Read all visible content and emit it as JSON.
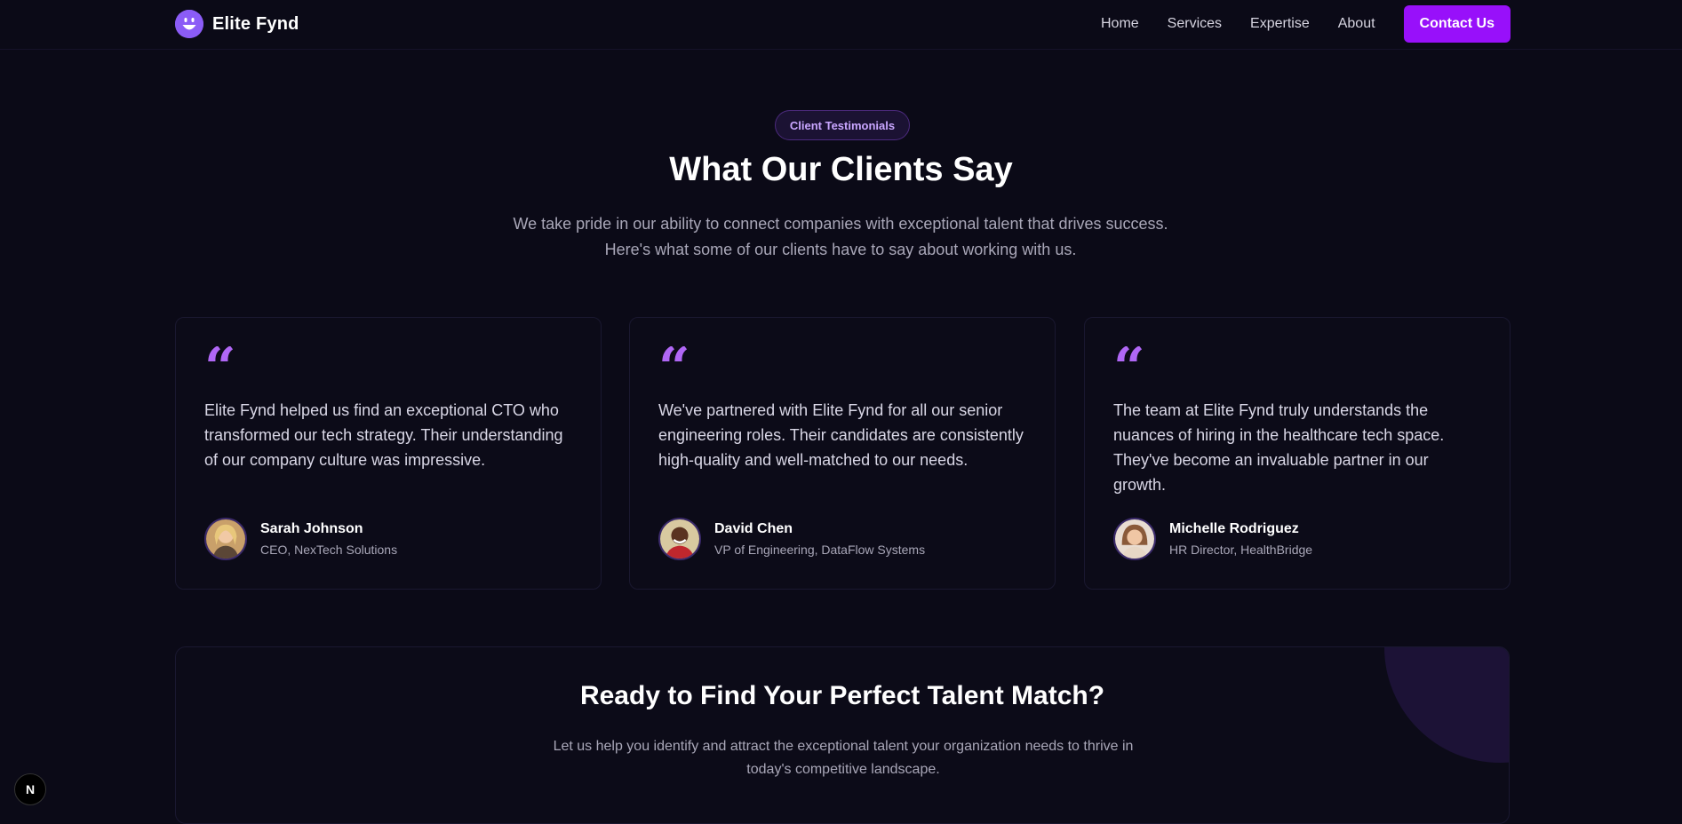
{
  "brand": {
    "name": "Elite Fynd",
    "logo_icon": "smiley-icon",
    "logo_color": "#8b5cf6"
  },
  "nav": {
    "links": [
      "Home",
      "Services",
      "Expertise",
      "About"
    ],
    "contact_label": "Contact Us",
    "accent": "#9810fa"
  },
  "testimonials": {
    "badge": "Client Testimonials",
    "title": "What Our Clients Say",
    "subtitle_line1": "We take pride in our ability to connect companies with exceptional talent that drives success.",
    "subtitle_line2": "Here's what some of our clients have to say about working with us.",
    "quote_mark": "“",
    "items": [
      {
        "quote": "Elite Fynd helped us find an exceptional CTO who transformed our tech strategy. Their understanding of our company culture was impressive.",
        "name": "Sarah Johnson",
        "role": "CEO, NexTech Solutions"
      },
      {
        "quote": "We've partnered with Elite Fynd for all our senior engineering roles. Their candidates are consistently high-quality and well-matched to our needs.",
        "name": "David Chen",
        "role": "VP of Engineering, DataFlow Systems"
      },
      {
        "quote": "The team at Elite Fynd truly understands the nuances of hiring in the healthcare tech space. They've become an invaluable partner in our growth.",
        "name": "Michelle Rodriguez",
        "role": "HR Director, HealthBridge"
      }
    ]
  },
  "cta": {
    "title": "Ready to Find Your Perfect Talent Match?",
    "subtitle_line1": "Let us help you identify and attract the exceptional talent your organization needs to thrive in",
    "subtitle_line2": "today's competitive landscape."
  },
  "dev_badge": {
    "label": "N"
  }
}
